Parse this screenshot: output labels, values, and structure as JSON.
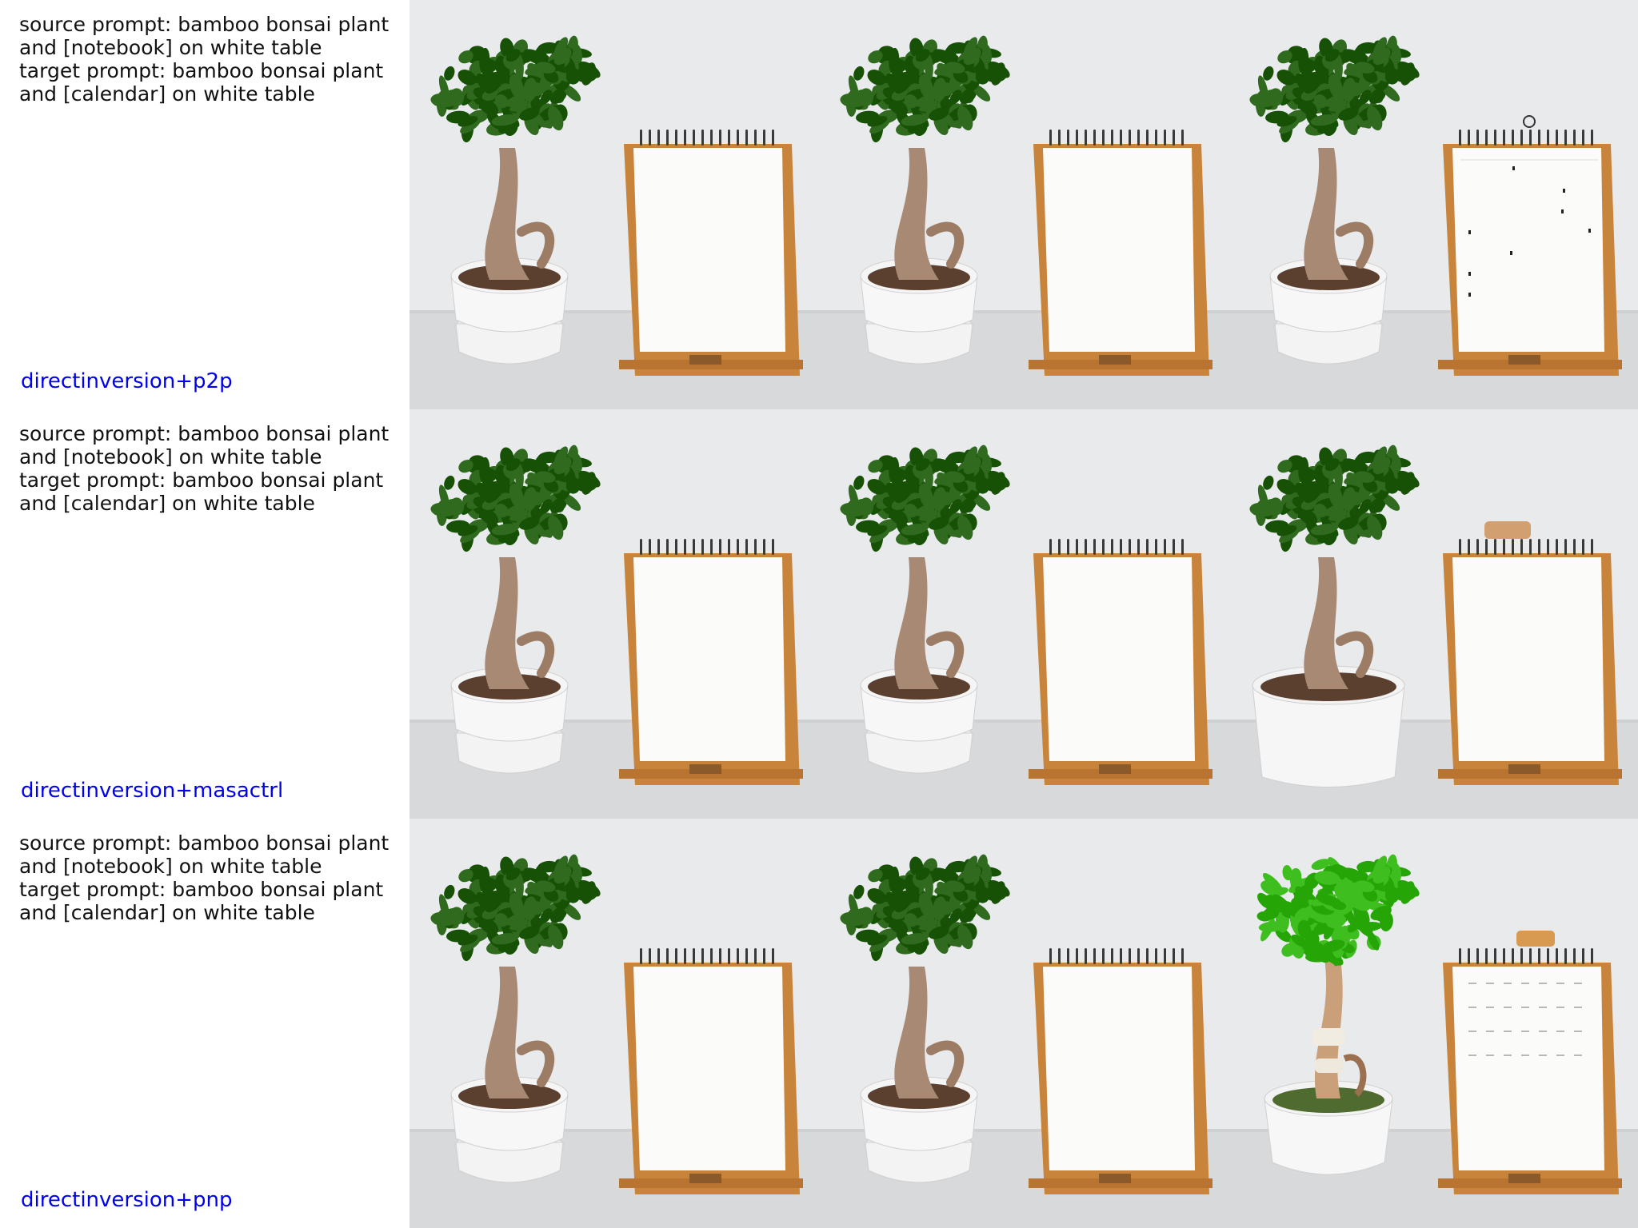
{
  "colors": {
    "method_label": "#0000ee",
    "prompt_text": "#111111",
    "wall": "#e9eaec",
    "table": "#d8d9db",
    "leaf_dark": "#2f6a1e",
    "leaf_bright": "#3fbf1f",
    "wood": "#c8843a",
    "paper": "#fbfbfa"
  },
  "rows": [
    {
      "source_prompt": "source prompt: bamboo bonsai plant",
      "source_prompt_2": "and [notebook] on white table",
      "target_prompt": "target prompt: bamboo bonsai plant",
      "target_prompt_2": "and [calendar] on white table",
      "method": "directinversion+p2p",
      "images": [
        {
          "content": "bonsai-with-notebook",
          "variant": "source"
        },
        {
          "content": "bonsai-with-notebook",
          "variant": "reconstruction"
        },
        {
          "content": "bonsai-with-calendar",
          "variant": "edited-calendar-marks"
        }
      ]
    },
    {
      "source_prompt": "source prompt: bamboo bonsai plant",
      "source_prompt_2": "and [notebook] on white table",
      "target_prompt": "target prompt: bamboo bonsai plant",
      "target_prompt_2": "and [calendar] on white table",
      "method": "directinversion+masactrl",
      "images": [
        {
          "content": "bonsai-with-notebook",
          "variant": "source"
        },
        {
          "content": "bonsai-with-notebook",
          "variant": "reconstruction"
        },
        {
          "content": "bonsai-with-calendar",
          "variant": "edited-single-pot"
        }
      ]
    },
    {
      "source_prompt": "source prompt: bamboo bonsai plant",
      "source_prompt_2": "and [notebook] on white table",
      "target_prompt": "target prompt: bamboo bonsai plant",
      "target_prompt_2": "and [calendar] on white table",
      "method": "directinversion+pnp",
      "images": [
        {
          "content": "bonsai-with-notebook",
          "variant": "source"
        },
        {
          "content": "bonsai-with-notebook",
          "variant": "reconstruction"
        },
        {
          "content": "bamboo-with-calendar",
          "variant": "edited-bamboo"
        }
      ]
    }
  ]
}
